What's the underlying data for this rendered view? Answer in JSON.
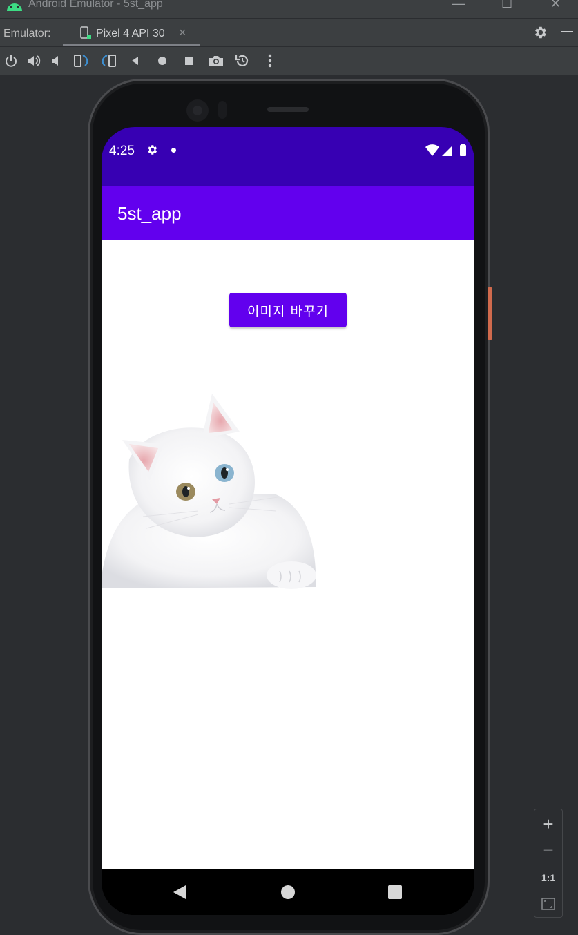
{
  "window": {
    "title": "Android Emulator - 5st_app"
  },
  "tabbar": {
    "label": "Emulator:",
    "tab_label": "Pixel 4 API 30"
  },
  "toolbar": {
    "icons": [
      "power-icon",
      "volume-up-icon",
      "volume-down-icon",
      "rotate-left-icon",
      "rotate-right-icon",
      "back-icon",
      "home-icon",
      "overview-icon",
      "camera-icon",
      "snapshot-icon",
      "more-icon"
    ]
  },
  "device": {
    "status_time": "4:25"
  },
  "app": {
    "title": "5st_app",
    "button_label": "이미지 바꾸기",
    "image_alt": "white kitten"
  },
  "zoom": {
    "zoom_in": "+",
    "zoom_out": "−",
    "actual_size": "1:1"
  },
  "colors": {
    "status_bar": "#3700b3",
    "app_bar": "#6200ee",
    "button": "#6200ee",
    "ide_background": "#2b2d30"
  }
}
